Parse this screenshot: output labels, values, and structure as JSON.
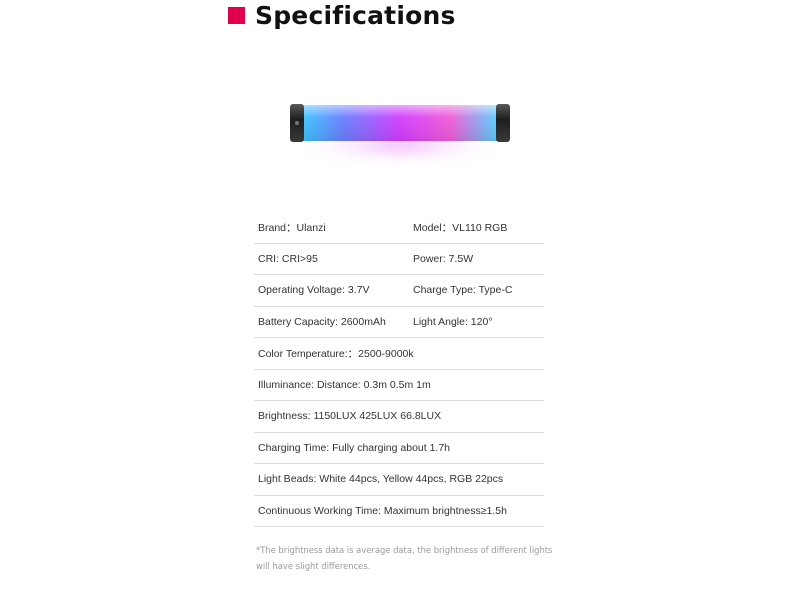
{
  "header": {
    "title": "Specifications",
    "accent_color": "#e0004d"
  },
  "product_image": {
    "icon": "rgb-light-tube"
  },
  "specs": {
    "rows": [
      {
        "c1": "Brand：Ulanzi",
        "c2": "Model：VL110 RGB"
      },
      {
        "c1": "CRI: CRI>95",
        "c2": "Power: 7.5W"
      },
      {
        "c1": "Operating Voltage: 3.7V",
        "c2": "Charge Type: Type-C"
      },
      {
        "c1": "Battery Capacity: 2600mAh",
        "c2": "Light Angle: 120°"
      },
      {
        "c1": "Color Temperature:：2500-9000k"
      },
      {
        "c1": "Illuminance: Distance: 0.3m 0.5m 1m"
      },
      {
        "c1": "Brightness: 1150LUX 425LUX 66.8LUX"
      },
      {
        "c1": "Charging Time: Fully charging about 1.7h"
      },
      {
        "c1": "Light Beads: White 44pcs, Yellow 44pcs, RGB 22pcs"
      },
      {
        "c1": "Continuous Working Time: Maximum brightness≥1.5h"
      }
    ]
  },
  "footnote": {
    "line1": "*The brightness data is average data, the brightness of different lights",
    "line2": "will have slight differences."
  }
}
